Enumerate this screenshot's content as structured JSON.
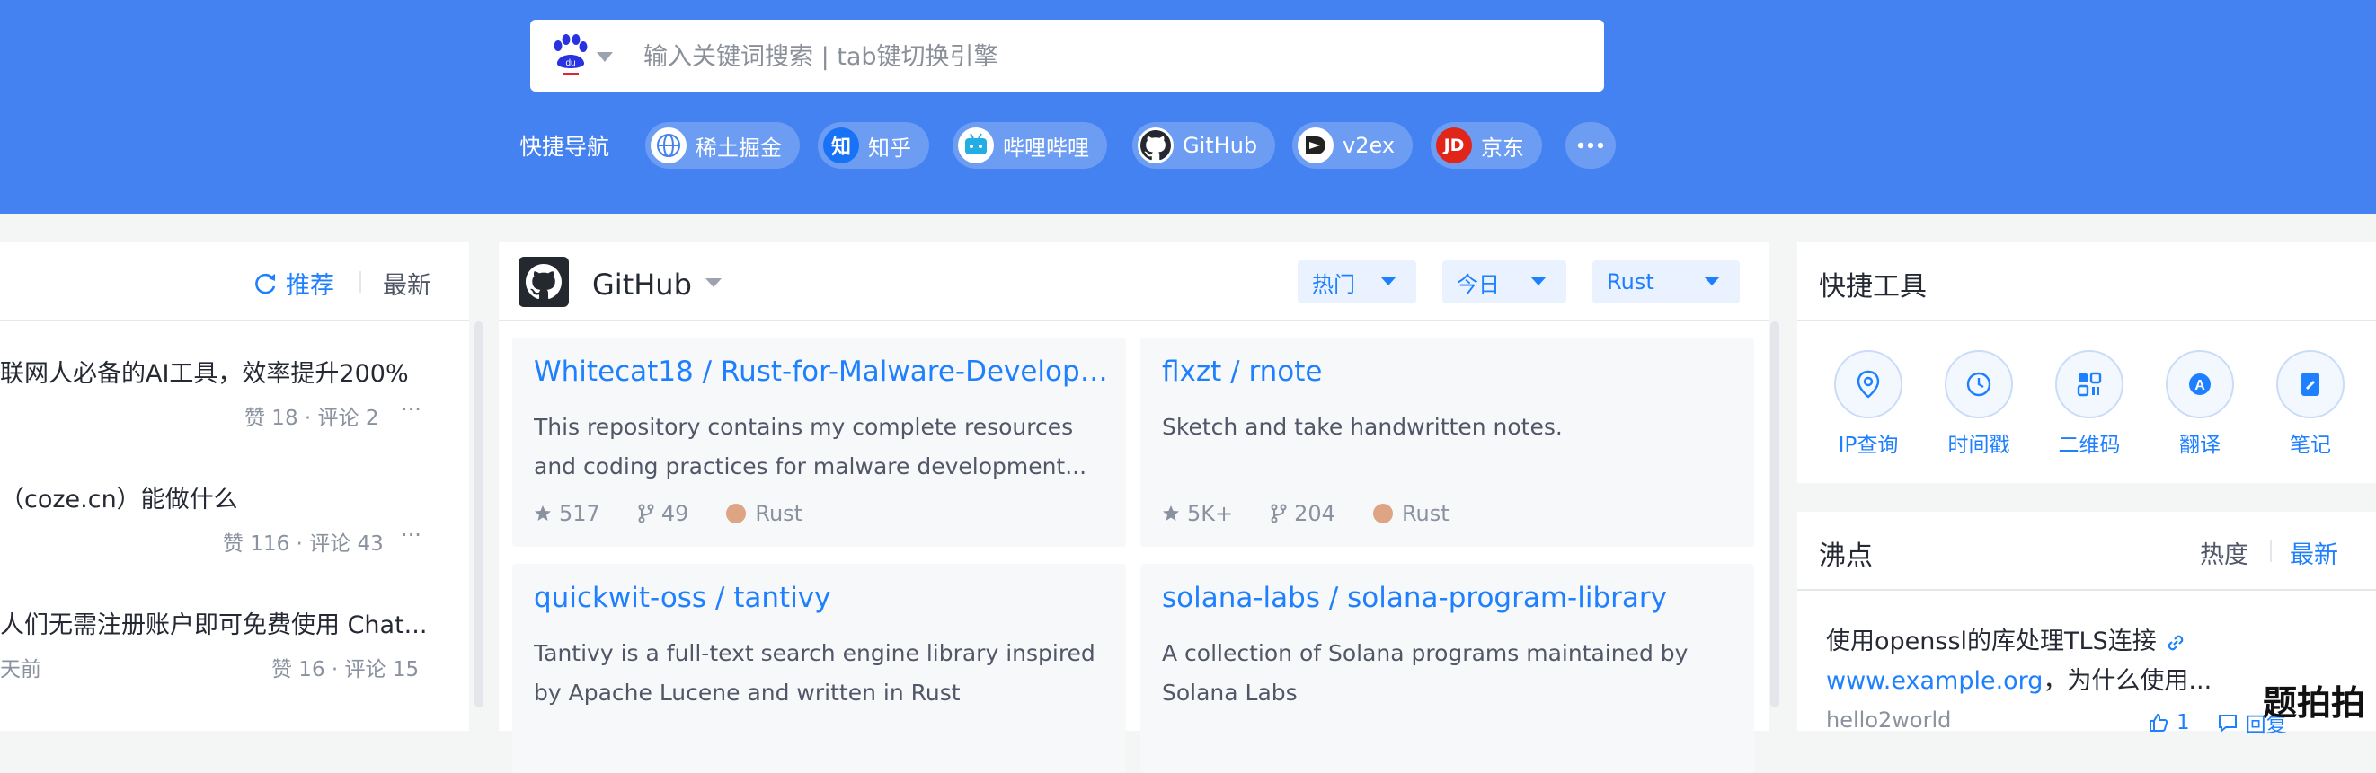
{
  "search": {
    "placeholder": "输入关键词搜索 | tab键切换引擎",
    "value": ""
  },
  "nav": {
    "label": "快捷导航",
    "items": [
      {
        "label": "稀土掘金",
        "icon": "globe-icon"
      },
      {
        "label": "知乎",
        "icon": "zhihu-icon"
      },
      {
        "label": "哔哩哔哩",
        "icon": "bilibili-icon"
      },
      {
        "label": "GitHub",
        "icon": "github-icon"
      },
      {
        "label": "v2ex",
        "icon": "v2ex-icon"
      },
      {
        "label": "京东",
        "icon": "jd-icon"
      }
    ],
    "more_icon": "more-icon"
  },
  "left": {
    "tab_recommend": "推荐",
    "tab_latest": "最新",
    "items": [
      {
        "title": "联网人必备的AI工具，效率提升200%",
        "meta": "赞 18 · 评论 2",
        "more": "···"
      },
      {
        "title": "（coze.cn）能做什么",
        "meta": "赞 116 · 评论 43",
        "more": "···"
      },
      {
        "title": "人们无需注册账户即可免费使用 Chat...",
        "time": "天前",
        "meta": "赞 16 · 评论 15"
      }
    ]
  },
  "github": {
    "title": "GitHub",
    "filter_sort": "热门",
    "filter_period": "今日",
    "filter_lang": "Rust",
    "repos": [
      {
        "name": "Whitecat18 / Rust-for-Malware-Development",
        "desc": "This repository contains my complete resources and coding practices for malware development...",
        "stars": "517",
        "forks": "49",
        "lang": "Rust"
      },
      {
        "name": "flxzt / rnote",
        "desc": "Sketch and take handwritten notes.",
        "stars": "5K+",
        "forks": "204",
        "lang": "Rust"
      },
      {
        "name": "quickwit-oss / tantivy",
        "desc": "Tantivy is a full-text search engine library inspired by Apache Lucene and written in Rust"
      },
      {
        "name": "solana-labs / solana-program-library",
        "desc": "A collection of Solana programs maintained by Solana Labs"
      }
    ]
  },
  "tools": {
    "title": "快捷工具",
    "items": [
      {
        "label": "IP查询",
        "icon": "location-icon"
      },
      {
        "label": "时间戳",
        "icon": "clock-icon"
      },
      {
        "label": "二维码",
        "icon": "qrcode-icon"
      },
      {
        "label": "翻译",
        "icon": "translate-icon"
      },
      {
        "label": "笔记",
        "icon": "note-icon"
      }
    ]
  },
  "hot": {
    "title": "沸点",
    "tab_hot": "热度",
    "tab_latest": "最新",
    "line1": "使用openssl的库处理TLS连接",
    "line2_link": "www.example.org",
    "line2_rest": "，为什么使用...",
    "user": "hello2world",
    "likes": "1",
    "reply": "回复",
    "more": "···"
  },
  "watermark": "题拍拍",
  "colors": {
    "header_bg": "#4382f0",
    "accent": "#1e80ff",
    "rust": "#dea584"
  }
}
